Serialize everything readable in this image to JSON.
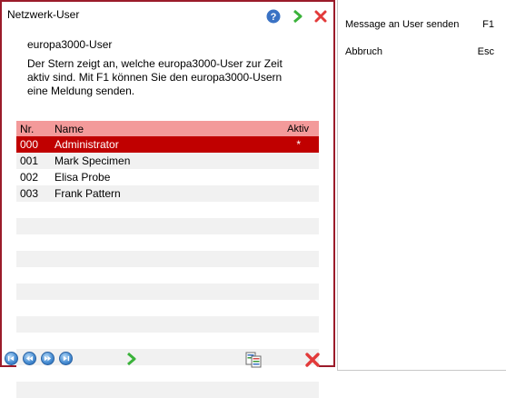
{
  "dialog": {
    "title": "Netzwerk-User",
    "heading": "europa3000-User",
    "description_line1": "Der Stern zeigt an, welche europa3000-User zur Zeit",
    "description_line2": "aktiv sind. Mit F1 können Sie den europa3000-Usern",
    "description_line3": "eine Meldung senden."
  },
  "table": {
    "columns": {
      "nr": "Nr.",
      "name": "Name",
      "aktiv": "Aktiv"
    },
    "rows": [
      {
        "nr": "000",
        "name": "Administrator",
        "aktiv": "*"
      },
      {
        "nr": "001",
        "name": "Mark Specimen",
        "aktiv": ""
      },
      {
        "nr": "002",
        "name": "Elisa Probe",
        "aktiv": ""
      },
      {
        "nr": "003",
        "name": "Frank Pattern",
        "aktiv": ""
      }
    ],
    "selected_row": 0
  },
  "side_menu": {
    "items": [
      {
        "label": "Message an User senden",
        "shortcut": "F1"
      },
      {
        "label": "Abbruch",
        "shortcut": "Esc"
      }
    ]
  },
  "icons": {
    "top": [
      "help-icon",
      "proceed-arrow-icon",
      "close-x-icon"
    ],
    "bottom": [
      "first-record-icon",
      "previous-record-icon",
      "next-record-icon",
      "last-record-icon",
      "confirm-arrow-icon",
      "documents-icon",
      "cancel-x-icon"
    ]
  },
  "colors": {
    "accent": "#9b1b2a",
    "header_bg": "#f39a9a",
    "selection_bg": "#c00000",
    "alt_row_bg": "#f1f1f1"
  }
}
